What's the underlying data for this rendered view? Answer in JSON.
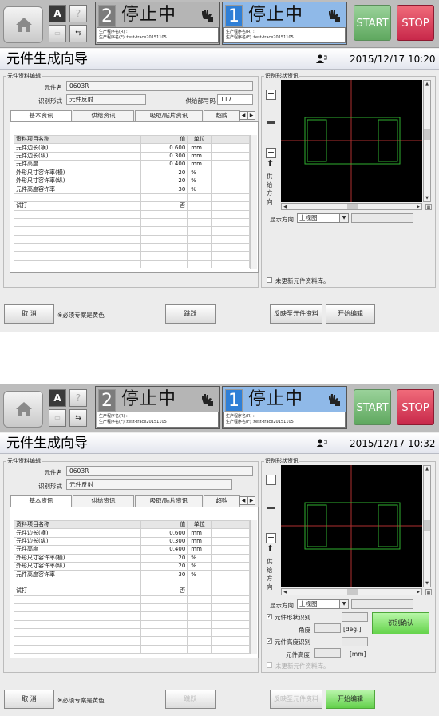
{
  "topbar": {
    "line1": {
      "number": "2",
      "status": "停止中",
      "prog_r": "生产程序名(R) :",
      "prog_f": "生产程序名(F) :test-trace20151105"
    },
    "line2": {
      "number": "1",
      "status": "停止中",
      "prog_r": "生产程序名(R) :",
      "prog_f": "生产程序名(F) :test-trace20151105"
    },
    "help_label": "?",
    "start_label": "START",
    "stop_label": "STOP"
  },
  "page_title": "元件生成向导",
  "screens": [
    {
      "datetime": "2015/12/17 10:20",
      "supply_id_label": "供给部号码",
      "supply_id_value": "117",
      "bottom": {
        "cancel": "取 消",
        "note": "※必须专案是黄色",
        "skip": "跳跃",
        "reflect": "反映至元件资料",
        "start_edit": "开始编辑"
      },
      "update_check_label": "未更新元件资料库。"
    },
    {
      "datetime": "2015/12/17 10:32",
      "bottom": {
        "cancel": "取 消",
        "note": "※必须专案是黄色",
        "skip": "跳跃",
        "reflect": "反映至元件资料",
        "start_edit": "开始编辑"
      },
      "shape_recog_label": "元件形状识别",
      "angle_label": "角度",
      "angle_unit": "[deg.]",
      "recog_confirm": "识别确认",
      "height_recog_label": "元件高度识别",
      "height_label": "元件高度",
      "height_unit": "[mm]",
      "update_check_label": "未更新元件资料库。"
    }
  ],
  "part_info": {
    "group_title": "元件资料编辑",
    "name_label": "元件名",
    "name_value": "0603R",
    "recog_label": "识别形式",
    "recog_value": "元件反射"
  },
  "tabs": [
    "基本资讯",
    "供给资讯",
    "吸取/贴片资讯",
    "超购"
  ],
  "table": {
    "headers": [
      "资料项目名称",
      "值",
      "单位"
    ],
    "rows": [
      {
        "name": "元件边长(横)",
        "value": "0.600",
        "unit": "mm"
      },
      {
        "name": "元件边长(纵)",
        "value": "0.300",
        "unit": "mm"
      },
      {
        "name": "元件高度",
        "value": "0.400",
        "unit": "mm"
      },
      {
        "name": "外形尺寸容许率(横)",
        "value": "20",
        "unit": "%"
      },
      {
        "name": "外形尺寸容许率(纵)",
        "value": "20",
        "unit": "%"
      },
      {
        "name": "元件高度容许率",
        "value": "30",
        "unit": "%"
      },
      {
        "name": "",
        "value": "",
        "unit": ""
      },
      {
        "name": "试打",
        "value": "否",
        "unit": ""
      }
    ]
  },
  "shape_panel": {
    "group_title": "识别形状资讯",
    "feed_dir": [
      "供",
      "给",
      "方",
      "向"
    ],
    "display_dir_label": "显示方向",
    "display_dir_value": "上视图"
  }
}
